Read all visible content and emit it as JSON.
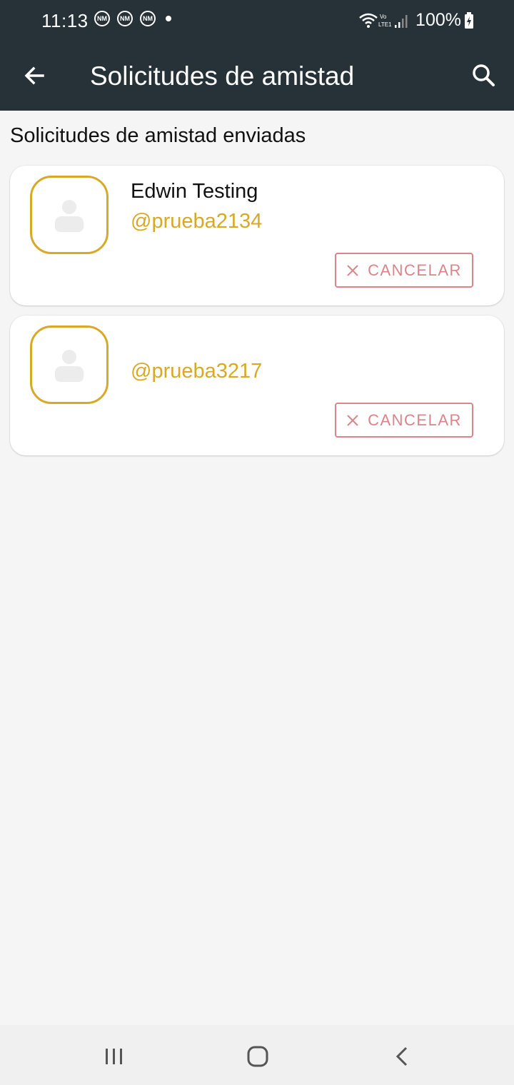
{
  "status_bar": {
    "time": "11:13",
    "notifications": [
      "NM",
      "NM",
      "NM"
    ],
    "battery": "100%",
    "icons": [
      "wifi-icon",
      "volte-icon",
      "signal-icon",
      "battery-charging-icon"
    ]
  },
  "app_bar": {
    "title": "Solicitudes de amistad",
    "back_icon": "arrow-back-icon",
    "search_icon": "search-icon"
  },
  "section": {
    "title": "Solicitudes de amistad enviadas"
  },
  "requests": [
    {
      "name": "Edwin Testing",
      "handle": "@prueba2134",
      "cancel_label": "CANCELAR"
    },
    {
      "name": "",
      "handle": "@prueba3217",
      "cancel_label": "CANCELAR"
    }
  ],
  "colors": {
    "header": "#263238",
    "accent": "#d8a927",
    "cancel": "#d9858a",
    "background": "#f5f5f5"
  }
}
